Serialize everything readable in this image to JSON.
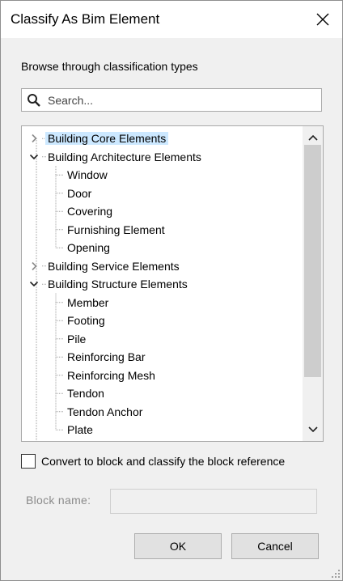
{
  "window": {
    "title": "Classify As Bim Element"
  },
  "browse_label": "Browse through classification types",
  "search": {
    "placeholder": "Search...",
    "value": ""
  },
  "tree": {
    "items": [
      {
        "label": "Building Core Elements",
        "level": 0,
        "state": "collapsed",
        "selected": true
      },
      {
        "label": "Building Architecture Elements",
        "level": 0,
        "state": "expanded",
        "selected": false
      },
      {
        "label": "Window",
        "level": 1,
        "state": "leaf",
        "selected": false
      },
      {
        "label": "Door",
        "level": 1,
        "state": "leaf",
        "selected": false
      },
      {
        "label": "Covering",
        "level": 1,
        "state": "leaf",
        "selected": false
      },
      {
        "label": "Furnishing Element",
        "level": 1,
        "state": "leaf",
        "selected": false
      },
      {
        "label": "Opening",
        "level": 1,
        "state": "leaf",
        "selected": false
      },
      {
        "label": "Building Service Elements",
        "level": 0,
        "state": "collapsed",
        "selected": false
      },
      {
        "label": "Building Structure Elements",
        "level": 0,
        "state": "expanded",
        "selected": false
      },
      {
        "label": "Member",
        "level": 1,
        "state": "leaf",
        "selected": false
      },
      {
        "label": "Footing",
        "level": 1,
        "state": "leaf",
        "selected": false
      },
      {
        "label": "Pile",
        "level": 1,
        "state": "leaf",
        "selected": false
      },
      {
        "label": "Reinforcing Bar",
        "level": 1,
        "state": "leaf",
        "selected": false
      },
      {
        "label": "Reinforcing Mesh",
        "level": 1,
        "state": "leaf",
        "selected": false
      },
      {
        "label": "Tendon",
        "level": 1,
        "state": "leaf",
        "selected": false
      },
      {
        "label": "Tendon Anchor",
        "level": 1,
        "state": "leaf",
        "selected": false
      },
      {
        "label": "Plate",
        "level": 1,
        "state": "leaf",
        "selected": false
      }
    ]
  },
  "convert_checkbox": {
    "label": "Convert to block and classify the block reference",
    "checked": false
  },
  "block_name": {
    "label": "Block name:",
    "value": "",
    "enabled": false
  },
  "buttons": {
    "ok": "OK",
    "cancel": "Cancel"
  },
  "colors": {
    "selection": "#cce8ff",
    "dialog_bg": "#f0f0f0",
    "scroll_thumb": "#cdcdcd"
  }
}
